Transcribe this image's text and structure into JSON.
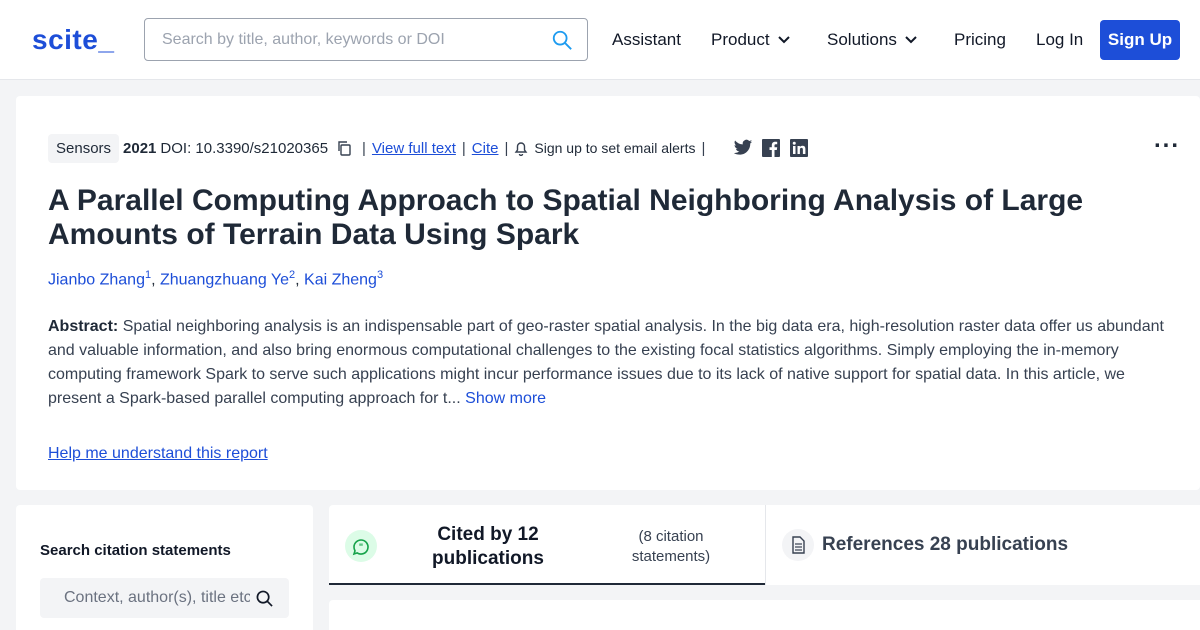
{
  "header": {
    "logo": "scite_",
    "search_placeholder": "Search by title, author, keywords or DOI",
    "nav": {
      "assistant": "Assistant",
      "product": "Product",
      "solutions": "Solutions",
      "pricing": "Pricing",
      "login": "Log In",
      "signup": "Sign Up"
    },
    "accent_color": "#1d4ed8"
  },
  "paper": {
    "journal": "Sensors",
    "year": "2021",
    "doi": "DOI: 10.3390/s21020365",
    "view_full_text": "View full text",
    "cite": "Cite",
    "separator": "|",
    "alerts": "Sign up to set email alerts",
    "menu": "...",
    "title": "A Parallel Computing Approach to Spatial Neighboring Analysis of Large Amounts of Terrain Data Using Spark",
    "authors": [
      {
        "name": "Jianbo Zhang",
        "sup": "1"
      },
      {
        "name": "Zhuangzhuang Ye",
        "sup": "2"
      },
      {
        "name": "Kai Zheng",
        "sup": "3"
      }
    ],
    "comma": ", ",
    "abstract_label": "Abstract:",
    "abstract_text": "Spatial neighboring analysis is an indispensable part of geo-raster spatial analysis. In the big data era, high-resolution raster data offer us abundant and valuable information, and also bring enormous computational challenges to the existing focal statistics algorithms. Simply employing the in-memory computing framework Spark to serve such applications might incur performance issues due to its lack of native support for spatial data. In this article, we present a Spark-based parallel computing approach for t...",
    "show_more": "Show more",
    "help_link": "Help me understand this report"
  },
  "citations_panel": {
    "heading": "Search citation statements",
    "search_placeholder": "Context, author(s), title etc."
  },
  "tabs": {
    "cited_by": "Cited by 12 publications",
    "cited_sub": "(8 citation statements)",
    "references": "References 28 publications"
  }
}
